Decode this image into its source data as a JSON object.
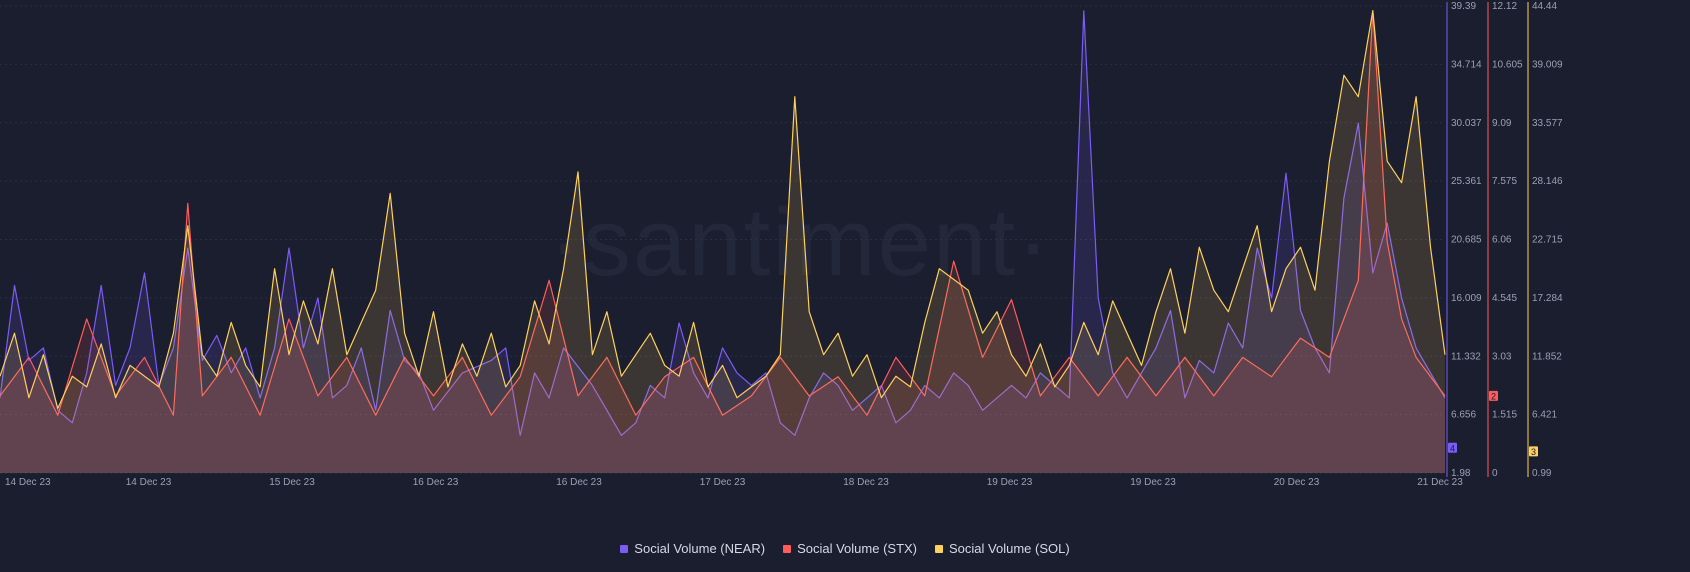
{
  "watermark": "·santiment·",
  "colors": {
    "background": "#1b1e2e",
    "near": "#7b5cf5",
    "stx": "#ff5b5b",
    "sol": "#ffd05b",
    "grid": "#2a2f44"
  },
  "chart_data": {
    "type": "line",
    "x_ticks": [
      "14 Dec 23",
      "14 Dec 23",
      "15 Dec 23",
      "16 Dec 23",
      "16 Dec 23",
      "17 Dec 23",
      "18 Dec 23",
      "19 Dec 23",
      "19 Dec 23",
      "20 Dec 23",
      "21 Dec 23"
    ],
    "axes": [
      {
        "series": "NEAR",
        "ticks": [
          "39.39",
          "34.714",
          "30.037",
          "25.361",
          "20.685",
          "16.009",
          "11.332",
          "6.656",
          "1.98"
        ],
        "ylim": [
          1.98,
          39.39
        ],
        "current": "4"
      },
      {
        "series": "STX",
        "ticks": [
          "12.12",
          "10.605",
          "9.09",
          "7.575",
          "6.06",
          "4.545",
          "3.03",
          "1.515",
          "0"
        ],
        "ylim": [
          0,
          12.12
        ],
        "current": "2"
      },
      {
        "series": "SOL",
        "ticks": [
          "44.44",
          "39.009",
          "33.577",
          "28.146",
          "22.715",
          "17.284",
          "11.852",
          "6.421",
          "0.99"
        ],
        "ylim": [
          0.99,
          44.44
        ],
        "current": "3"
      }
    ],
    "series": [
      {
        "name": "Social Volume (NEAR)",
        "points": [
          [
            0,
            8
          ],
          [
            0.01,
            17
          ],
          [
            0.02,
            11
          ],
          [
            0.03,
            12
          ],
          [
            0.04,
            7
          ],
          [
            0.05,
            6
          ],
          [
            0.06,
            10
          ],
          [
            0.07,
            17
          ],
          [
            0.08,
            9
          ],
          [
            0.09,
            12
          ],
          [
            0.1,
            18
          ],
          [
            0.11,
            9
          ],
          [
            0.12,
            12
          ],
          [
            0.13,
            20
          ],
          [
            0.14,
            11
          ],
          [
            0.15,
            13
          ],
          [
            0.16,
            10
          ],
          [
            0.17,
            12
          ],
          [
            0.18,
            8
          ],
          [
            0.19,
            12
          ],
          [
            0.2,
            20
          ],
          [
            0.21,
            12
          ],
          [
            0.22,
            16
          ],
          [
            0.23,
            8
          ],
          [
            0.24,
            9
          ],
          [
            0.25,
            12
          ],
          [
            0.26,
            7
          ],
          [
            0.27,
            15
          ],
          [
            0.28,
            11
          ],
          [
            0.29,
            10
          ],
          [
            0.3,
            7
          ],
          [
            0.32,
            10
          ],
          [
            0.34,
            11
          ],
          [
            0.35,
            12
          ],
          [
            0.36,
            5
          ],
          [
            0.37,
            10
          ],
          [
            0.38,
            8
          ],
          [
            0.39,
            12
          ],
          [
            0.41,
            9
          ],
          [
            0.42,
            7
          ],
          [
            0.43,
            5
          ],
          [
            0.44,
            6
          ],
          [
            0.45,
            9
          ],
          [
            0.46,
            8
          ],
          [
            0.47,
            14
          ],
          [
            0.48,
            10
          ],
          [
            0.49,
            8
          ],
          [
            0.5,
            12
          ],
          [
            0.51,
            10
          ],
          [
            0.52,
            9
          ],
          [
            0.53,
            10
          ],
          [
            0.54,
            6
          ],
          [
            0.55,
            5
          ],
          [
            0.56,
            8
          ],
          [
            0.57,
            10
          ],
          [
            0.58,
            9
          ],
          [
            0.59,
            7
          ],
          [
            0.6,
            8
          ],
          [
            0.61,
            9
          ],
          [
            0.62,
            6
          ],
          [
            0.63,
            7
          ],
          [
            0.64,
            9
          ],
          [
            0.65,
            8
          ],
          [
            0.66,
            10
          ],
          [
            0.67,
            9
          ],
          [
            0.68,
            7
          ],
          [
            0.69,
            8
          ],
          [
            0.7,
            9
          ],
          [
            0.71,
            8
          ],
          [
            0.72,
            10
          ],
          [
            0.73,
            9
          ],
          [
            0.74,
            8
          ],
          [
            0.75,
            39
          ],
          [
            0.76,
            16
          ],
          [
            0.77,
            10
          ],
          [
            0.78,
            8
          ],
          [
            0.79,
            10
          ],
          [
            0.8,
            12
          ],
          [
            0.81,
            15
          ],
          [
            0.82,
            8
          ],
          [
            0.83,
            11
          ],
          [
            0.84,
            10
          ],
          [
            0.85,
            14
          ],
          [
            0.86,
            12
          ],
          [
            0.87,
            20
          ],
          [
            0.88,
            16
          ],
          [
            0.89,
            26
          ],
          [
            0.9,
            15
          ],
          [
            0.91,
            12
          ],
          [
            0.92,
            10
          ],
          [
            0.93,
            24
          ],
          [
            0.94,
            30
          ],
          [
            0.95,
            18
          ],
          [
            0.96,
            22
          ],
          [
            0.97,
            16
          ],
          [
            0.98,
            12
          ],
          [
            0.99,
            10
          ],
          [
            1,
            8
          ]
        ]
      },
      {
        "name": "Social Volume (STX)",
        "points": [
          [
            0,
            2
          ],
          [
            0.02,
            3
          ],
          [
            0.04,
            1.5
          ],
          [
            0.06,
            4
          ],
          [
            0.08,
            2
          ],
          [
            0.1,
            3
          ],
          [
            0.12,
            1.5
          ],
          [
            0.13,
            7
          ],
          [
            0.14,
            2
          ],
          [
            0.16,
            3
          ],
          [
            0.18,
            1.5
          ],
          [
            0.2,
            4
          ],
          [
            0.22,
            2
          ],
          [
            0.24,
            3
          ],
          [
            0.26,
            1.5
          ],
          [
            0.28,
            3
          ],
          [
            0.3,
            2
          ],
          [
            0.32,
            3
          ],
          [
            0.34,
            1.5
          ],
          [
            0.36,
            2.5
          ],
          [
            0.38,
            5
          ],
          [
            0.4,
            2
          ],
          [
            0.42,
            3
          ],
          [
            0.44,
            1.5
          ],
          [
            0.46,
            2.5
          ],
          [
            0.48,
            3
          ],
          [
            0.5,
            1.5
          ],
          [
            0.52,
            2
          ],
          [
            0.54,
            3
          ],
          [
            0.56,
            2
          ],
          [
            0.58,
            2.5
          ],
          [
            0.6,
            1.5
          ],
          [
            0.62,
            3
          ],
          [
            0.64,
            2
          ],
          [
            0.66,
            5.5
          ],
          [
            0.68,
            3
          ],
          [
            0.7,
            4.5
          ],
          [
            0.72,
            2
          ],
          [
            0.74,
            3
          ],
          [
            0.76,
            2
          ],
          [
            0.78,
            3
          ],
          [
            0.8,
            2
          ],
          [
            0.82,
            3
          ],
          [
            0.84,
            2
          ],
          [
            0.86,
            3
          ],
          [
            0.88,
            2.5
          ],
          [
            0.9,
            3.5
          ],
          [
            0.92,
            3
          ],
          [
            0.94,
            5
          ],
          [
            0.95,
            12
          ],
          [
            0.96,
            6
          ],
          [
            0.97,
            4
          ],
          [
            0.98,
            3
          ],
          [
            1,
            2
          ]
        ]
      },
      {
        "name": "Social Volume (SOL)",
        "points": [
          [
            0,
            10
          ],
          [
            0.01,
            14
          ],
          [
            0.02,
            8
          ],
          [
            0.03,
            12
          ],
          [
            0.04,
            7
          ],
          [
            0.05,
            10
          ],
          [
            0.06,
            9
          ],
          [
            0.07,
            13
          ],
          [
            0.08,
            8
          ],
          [
            0.09,
            11
          ],
          [
            0.1,
            10
          ],
          [
            0.11,
            9
          ],
          [
            0.12,
            14
          ],
          [
            0.13,
            24
          ],
          [
            0.14,
            12
          ],
          [
            0.15,
            10
          ],
          [
            0.16,
            15
          ],
          [
            0.17,
            11
          ],
          [
            0.18,
            9
          ],
          [
            0.19,
            20
          ],
          [
            0.2,
            12
          ],
          [
            0.21,
            17
          ],
          [
            0.22,
            13
          ],
          [
            0.23,
            20
          ],
          [
            0.24,
            12
          ],
          [
            0.25,
            15
          ],
          [
            0.26,
            18
          ],
          [
            0.27,
            27
          ],
          [
            0.28,
            14
          ],
          [
            0.29,
            10
          ],
          [
            0.3,
            16
          ],
          [
            0.31,
            9
          ],
          [
            0.32,
            13
          ],
          [
            0.33,
            10
          ],
          [
            0.34,
            14
          ],
          [
            0.35,
            9
          ],
          [
            0.36,
            11
          ],
          [
            0.37,
            17
          ],
          [
            0.38,
            13
          ],
          [
            0.39,
            20
          ],
          [
            0.4,
            29
          ],
          [
            0.41,
            12
          ],
          [
            0.42,
            16
          ],
          [
            0.43,
            10
          ],
          [
            0.44,
            12
          ],
          [
            0.45,
            14
          ],
          [
            0.46,
            11
          ],
          [
            0.47,
            10
          ],
          [
            0.48,
            15
          ],
          [
            0.49,
            9
          ],
          [
            0.5,
            11
          ],
          [
            0.51,
            8
          ],
          [
            0.52,
            9
          ],
          [
            0.53,
            10
          ],
          [
            0.54,
            12
          ],
          [
            0.55,
            36
          ],
          [
            0.56,
            16
          ],
          [
            0.57,
            12
          ],
          [
            0.58,
            14
          ],
          [
            0.59,
            10
          ],
          [
            0.6,
            12
          ],
          [
            0.61,
            8
          ],
          [
            0.62,
            10
          ],
          [
            0.63,
            9
          ],
          [
            0.64,
            15
          ],
          [
            0.65,
            20
          ],
          [
            0.66,
            19
          ],
          [
            0.67,
            18
          ],
          [
            0.68,
            14
          ],
          [
            0.69,
            16
          ],
          [
            0.7,
            12
          ],
          [
            0.71,
            10
          ],
          [
            0.72,
            13
          ],
          [
            0.73,
            9
          ],
          [
            0.74,
            11
          ],
          [
            0.75,
            15
          ],
          [
            0.76,
            12
          ],
          [
            0.77,
            17
          ],
          [
            0.78,
            14
          ],
          [
            0.79,
            11
          ],
          [
            0.8,
            16
          ],
          [
            0.81,
            20
          ],
          [
            0.82,
            14
          ],
          [
            0.83,
            22
          ],
          [
            0.84,
            18
          ],
          [
            0.85,
            16
          ],
          [
            0.86,
            20
          ],
          [
            0.87,
            24
          ],
          [
            0.88,
            16
          ],
          [
            0.89,
            20
          ],
          [
            0.9,
            22
          ],
          [
            0.91,
            18
          ],
          [
            0.92,
            30
          ],
          [
            0.93,
            38
          ],
          [
            0.94,
            36
          ],
          [
            0.95,
            44
          ],
          [
            0.96,
            30
          ],
          [
            0.97,
            28
          ],
          [
            0.98,
            36
          ],
          [
            0.99,
            22
          ],
          [
            1,
            12
          ]
        ]
      }
    ],
    "legend_placement": "bottom-center"
  },
  "legend": [
    {
      "label": "Social Volume (NEAR)",
      "color": "#7b5cf5"
    },
    {
      "label": "Social Volume (STX)",
      "color": "#ff5b5b"
    },
    {
      "label": "Social Volume (SOL)",
      "color": "#ffd05b"
    }
  ]
}
